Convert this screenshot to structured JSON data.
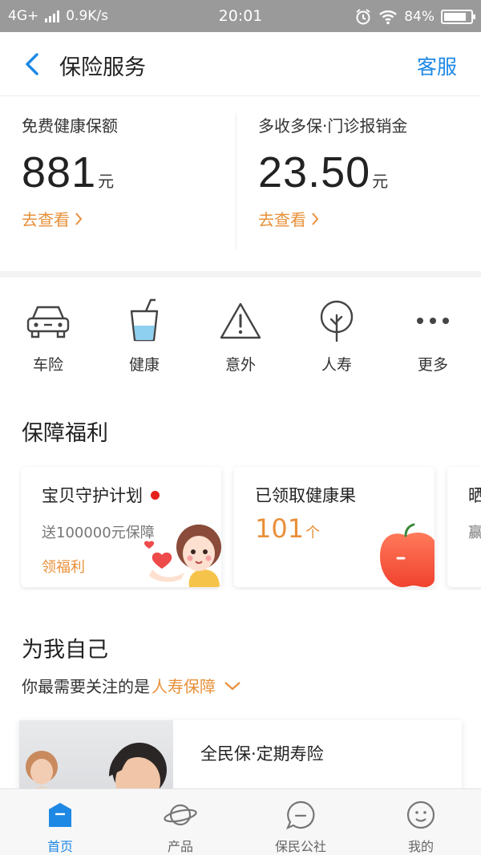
{
  "status_bar": {
    "network": "4G+",
    "speed": "0.9K/s",
    "time": "20:01",
    "battery": "84%",
    "battery_level": 0.84
  },
  "header": {
    "title": "保险服务",
    "service_label": "客服"
  },
  "quota": {
    "left": {
      "label": "免费健康保额",
      "amount": "881",
      "unit": "元",
      "link": "去查看"
    },
    "right": {
      "label": "多收多保·门诊报销金",
      "amount": "23.50",
      "unit": "元",
      "link": "去查看"
    }
  },
  "categories": [
    {
      "label": "车险",
      "icon": "car-icon"
    },
    {
      "label": "健康",
      "icon": "cup-icon"
    },
    {
      "label": "意外",
      "icon": "warning-icon"
    },
    {
      "label": "人寿",
      "icon": "tree-icon"
    },
    {
      "label": "更多",
      "icon": "more-dots-icon"
    }
  ],
  "benefits": {
    "title": "保障福利",
    "cards": [
      {
        "title": "宝贝守护计划",
        "subtitle": "送100000元保障",
        "link": "领福利",
        "icon": "girl-heart-icon"
      },
      {
        "title": "已领取健康果",
        "count": "101",
        "unit": "个",
        "icon": "apple-icon"
      },
      {
        "title": "晒",
        "subtitle": "赢"
      }
    ]
  },
  "for_me": {
    "title": "为我自己",
    "hint_prefix": "你最需要关注的是",
    "hint_highlight": "人寿保障",
    "product": {
      "title": "全民保·定期寿险"
    }
  },
  "bottom_nav": [
    {
      "label": "首页",
      "icon": "home-icon",
      "active": true
    },
    {
      "label": "产品",
      "icon": "planet-icon",
      "active": false
    },
    {
      "label": "保民公社",
      "icon": "chat-bubble-icon",
      "active": false
    },
    {
      "label": "我的",
      "icon": "profile-icon",
      "active": false
    }
  ],
  "colors": {
    "accent": "#1e88e5",
    "orange": "#e8903a",
    "red_dot": "#e6201a"
  }
}
